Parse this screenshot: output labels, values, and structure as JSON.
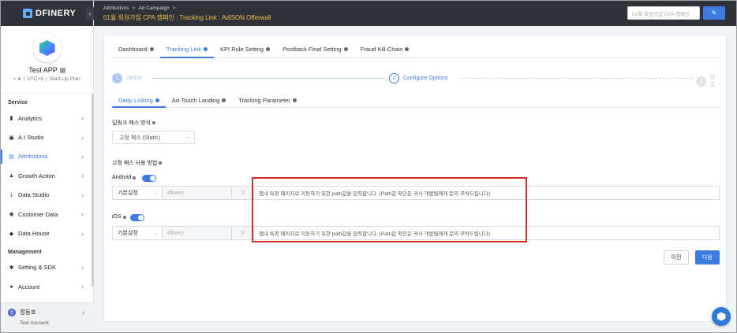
{
  "brand": {
    "name": "DFINERY"
  },
  "app": {
    "name": "Test APP",
    "timezone": "UTC+9",
    "plan": "Start-Up Plan"
  },
  "sidebar": {
    "section_service": "Service",
    "section_management": "Management",
    "items": [
      {
        "label": "Analytics",
        "icon": "bar-chart-icon"
      },
      {
        "label": "A.I Studio",
        "icon": "ai-icon"
      },
      {
        "label": "Attributions",
        "icon": "attribution-icon"
      },
      {
        "label": "Growth Action",
        "icon": "growth-icon"
      },
      {
        "label": "Data Studio",
        "icon": "download-icon"
      },
      {
        "label": "Customer Data",
        "icon": "target-icon"
      },
      {
        "label": "Data House",
        "icon": "database-icon"
      },
      {
        "label": "Setting & SDK",
        "icon": "gear-icon"
      },
      {
        "label": "Account",
        "icon": "person-icon"
      }
    ],
    "user": {
      "name": "정동호",
      "initial": "정",
      "account": "Test Account"
    }
  },
  "header": {
    "breadcrumb": [
      "Attributions",
      ">",
      "Ad Campaign",
      ">"
    ],
    "title": "01월 회원가입 CPA 캠페인 : Tracking Link : AdiSON Offerwall",
    "search_value": "01월 회원가입 CPA 캠페인"
  },
  "tabs": [
    "Dashboard",
    "Tracking Link",
    "KPI Rule Setting",
    "Postback Final Setting",
    "Fraud Kill-Chain"
  ],
  "steps": [
    {
      "num": "1",
      "label": "Define"
    },
    {
      "num": "2",
      "label": "Configure Options"
    },
    {
      "num": "3",
      "label": "완료"
    }
  ],
  "subtabs": [
    "Deep Linking",
    "Ad-Touch Landing",
    "Tracking Parameter"
  ],
  "form": {
    "deeplink_path_label": "딥링크 패스 방식",
    "deeplink_path_value": "고정 패스 (Static)",
    "static_usage_label": "고정 패스 사용 방법",
    "android_label": "Android",
    "ios_label": "iOS",
    "android_row": {
      "scheme": "기본설정",
      "domain": "dfinery",
      "separator": "://",
      "path": "앱내 특정 페이지로 이동하기 위한 path값을 입력합니다. (Path값 확인은 귀사 개발팀에게 문의 부탁드립니다)"
    },
    "ios_row": {
      "scheme": "기본설정",
      "domain": "dfinery",
      "separator": "://",
      "path": "앱내 특정 페이지로 이동하기 위한 path값을 입력합니다. (Path값 확인은 귀사 개발팀에게 문의 부탁드립니다)"
    }
  },
  "buttons": {
    "prev": "이전",
    "next": "다음"
  },
  "colors": {
    "accent": "#3d7be0",
    "header_bg": "#2f3238",
    "highlight": "#d62b2b",
    "title": "#f0c04a"
  }
}
